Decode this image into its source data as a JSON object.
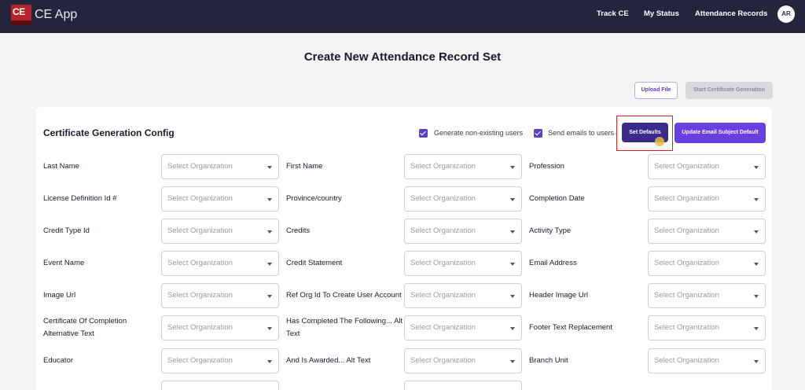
{
  "header": {
    "logo_text": "CE",
    "app_title": "CE App",
    "nav": [
      "Track CE",
      "My Status",
      "Attendance Records"
    ],
    "avatar_initials": "AR"
  },
  "page_title": "Create New Attendance Record Set",
  "actions": {
    "upload_label": "Upload File",
    "start_label": "Start Certificate Generation"
  },
  "config": {
    "title": "Certificate Generation Config",
    "generate_label": "Generate non-existing users",
    "send_label": "Send emails to users",
    "set_defaults_label": "Set Defaults",
    "update_email_label": "Update Email Subject Default",
    "generate_checked": true,
    "send_checked": true
  },
  "placeholder": "Select Organization",
  "fields": {
    "col1": [
      "Last Name",
      "License Definition Id #",
      "Credit Type Id",
      "Event Name",
      "Image Url",
      "Certificate Of Completion Alternative Text",
      "Educator"
    ],
    "col2": [
      "First Name",
      "Province/country",
      "Credits",
      "Credit Statement",
      "Ref Org Id To Create User Account",
      "Has Completed The Following... Alt Text",
      "And Is Awarded... Alt Text"
    ],
    "col3": [
      "Profession",
      "Completion Date",
      "Activity Type",
      "Email Address",
      "Header Image Url",
      "Footer Text Replacement",
      "Branch Unit"
    ]
  },
  "colors": {
    "topbar": "#23253c",
    "accent": "#6a3fe0",
    "accent_dark": "#3b2a8c",
    "highlight": "#e02020"
  }
}
